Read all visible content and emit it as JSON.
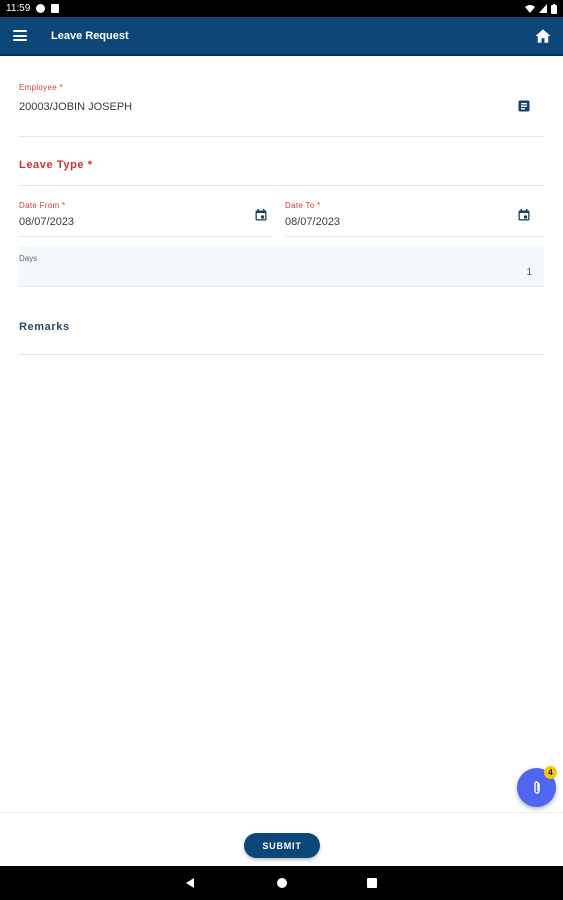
{
  "status_bar": {
    "time": "11:59"
  },
  "app_bar": {
    "title": "Leave Request",
    "menu_icon": "hamburger-menu-icon",
    "home_icon": "home-icon"
  },
  "form": {
    "employee": {
      "label": "Employee *",
      "value": "20003/JOBIN JOSEPH",
      "icon": "contact-card-icon"
    },
    "leave_type": {
      "label": "Leave Type *"
    },
    "date_from": {
      "label": "Date From *",
      "value": "08/07/2023",
      "icon": "calendar-icon"
    },
    "date_to": {
      "label": "Date To *",
      "value": "08/07/2023",
      "icon": "calendar-icon"
    },
    "days": {
      "label": "Days",
      "value": "1"
    },
    "remarks": {
      "label": "Remarks"
    }
  },
  "fab": {
    "icon": "paperclip-attachment-icon",
    "badge": "4"
  },
  "actions": {
    "submit_label": "SUBMIT"
  },
  "colors": {
    "primary": "#0c4777",
    "required_label": "#d23b3b",
    "fab": "#5166f0",
    "badge": "#f5c518"
  }
}
